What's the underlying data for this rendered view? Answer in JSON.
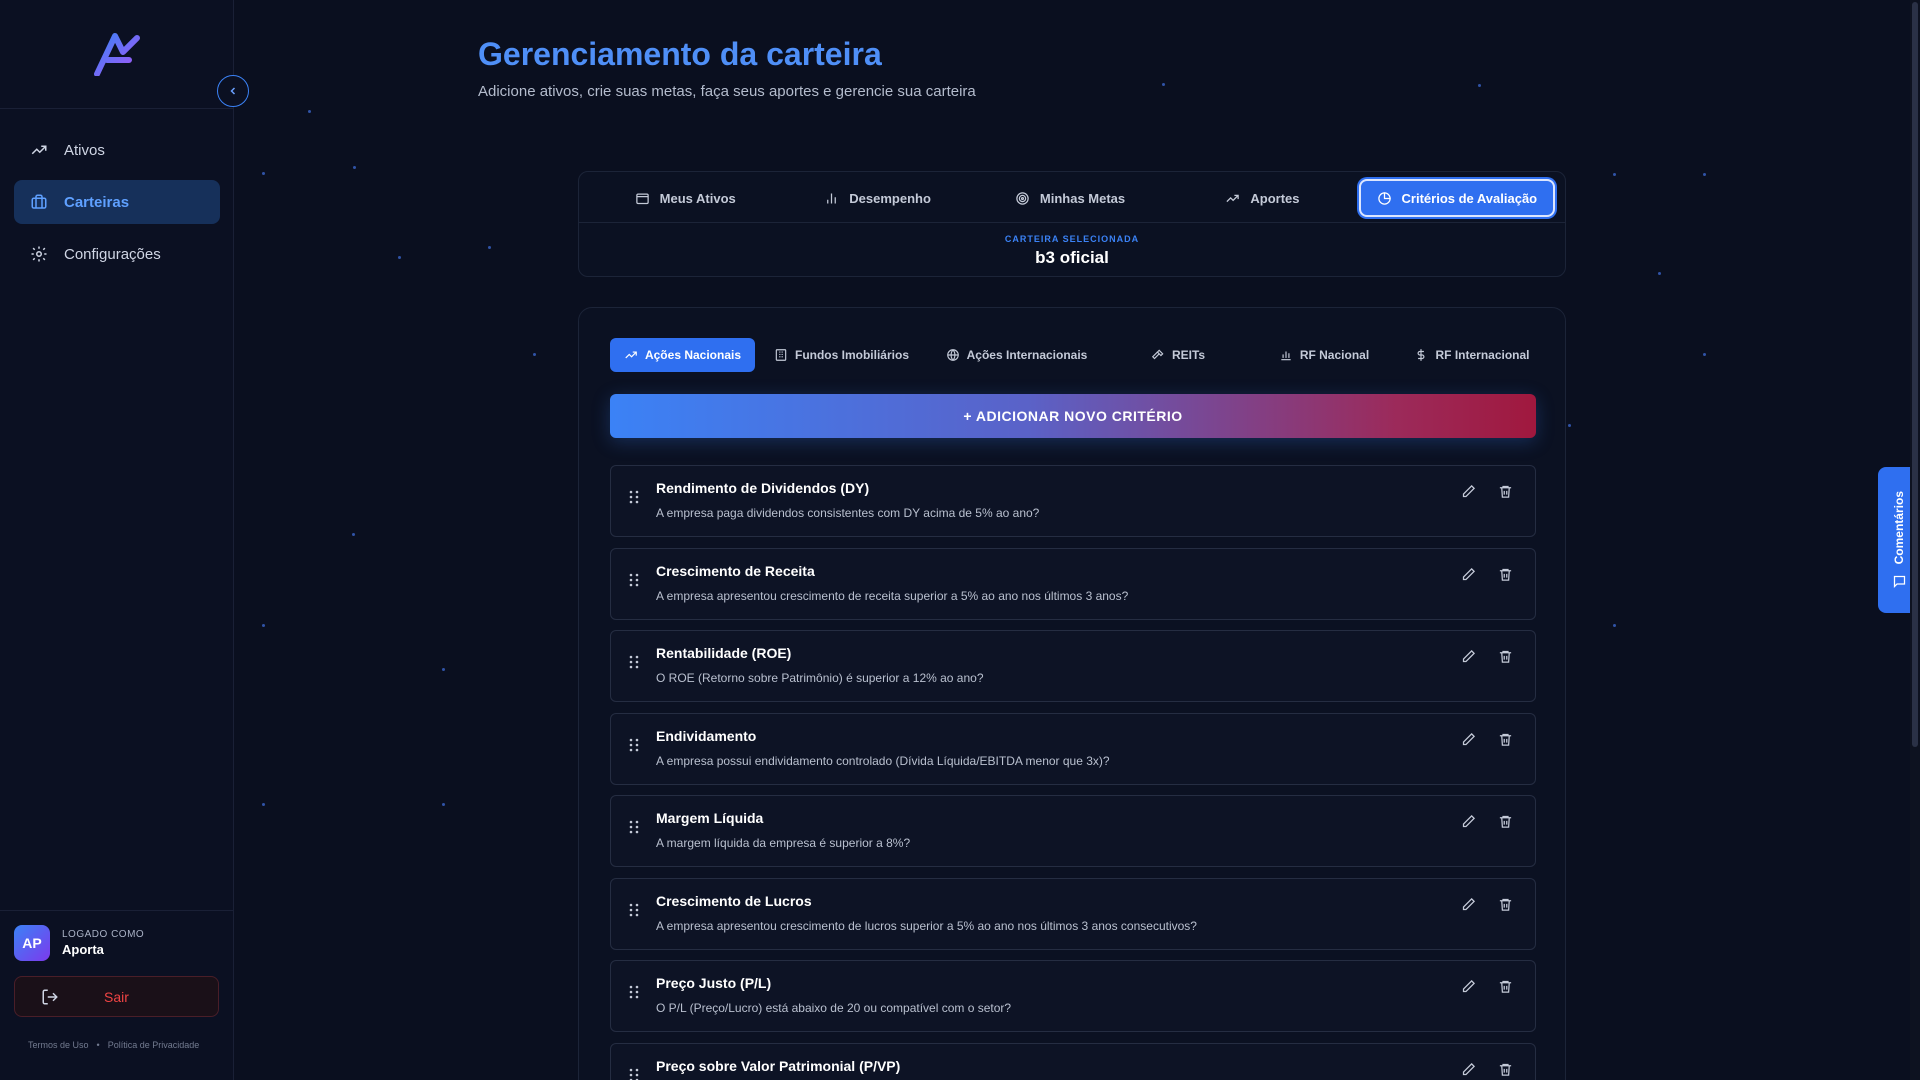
{
  "sidebar": {
    "nav": [
      {
        "label": "Ativos",
        "icon": "trending-up-icon"
      },
      {
        "label": "Carteiras",
        "icon": "briefcase-icon",
        "active": true
      },
      {
        "label": "Configurações",
        "icon": "gear-icon"
      }
    ],
    "user": {
      "initials": "AP",
      "caption": "LOGADO COMO",
      "name": "Aporta"
    },
    "logout_label": "Sair",
    "footer": {
      "terms": "Termos de Uso",
      "separator": "•",
      "privacy": "Política de Privacidade"
    }
  },
  "header": {
    "title": "Gerenciamento da carteira",
    "subtitle": "Adicione ativos, crie suas metas, faça seus aportes e gerencie sua carteira"
  },
  "main_tabs": [
    {
      "label": "Meus Ativos",
      "icon": "wallet-icon"
    },
    {
      "label": "Desempenho",
      "icon": "bar-chart-icon"
    },
    {
      "label": "Minhas Metas",
      "icon": "target-icon"
    },
    {
      "label": "Aportes",
      "icon": "trending-up-icon"
    },
    {
      "label": "Critérios de Avaliação",
      "icon": "pie-chart-icon",
      "active": true
    }
  ],
  "selected_portfolio": {
    "caption": "CARTEIRA SELECIONADA",
    "name": "b3 oficial"
  },
  "category_tabs": [
    {
      "label": "Ações Nacionais",
      "icon": "trending-up-icon",
      "active": true
    },
    {
      "label": "Fundos Imobiliários",
      "icon": "building-icon"
    },
    {
      "label": "Ações Internacionais",
      "icon": "globe-icon"
    },
    {
      "label": "REITs",
      "icon": "hammer-icon"
    },
    {
      "label": "RF Nacional",
      "icon": "bar-chart-icon"
    },
    {
      "label": "RF Internacional",
      "icon": "dollar-icon"
    }
  ],
  "add_button_label": "+ ADICIONAR NOVO CRITÉRIO",
  "criteria": [
    {
      "title": "Rendimento de Dividendos (DY)",
      "description": "A empresa paga dividendos consistentes com DY acima de 5% ao ano?"
    },
    {
      "title": "Crescimento de Receita",
      "description": "A empresa apresentou crescimento de receita superior a 5% ao ano nos últimos 3 anos?"
    },
    {
      "title": "Rentabilidade (ROE)",
      "description": "O ROE (Retorno sobre Patrimônio) é superior a 12% ao ano?"
    },
    {
      "title": "Endividamento",
      "description": "A empresa possui endividamento controlado (Dívida Líquida/EBITDA menor que 3x)?"
    },
    {
      "title": "Margem Líquida",
      "description": "A margem líquida da empresa é superior a 8%?"
    },
    {
      "title": "Crescimento de Lucros",
      "description": "A empresa apresentou crescimento de lucros superior a 5% ao ano nos últimos 3 anos consecutivos?"
    },
    {
      "title": "Preço Justo (P/L)",
      "description": "O P/L (Preço/Lucro) está abaixo de 20 ou compatível com o setor?"
    },
    {
      "title": "Preço sobre Valor Patrimonial (P/VP)",
      "description": ""
    }
  ],
  "comments_tab_label": "Comentários",
  "colors": {
    "accent": "#2f6ff0",
    "title": "#4f8ff7",
    "danger": "#ef4444",
    "background": "#0a0f1f"
  }
}
